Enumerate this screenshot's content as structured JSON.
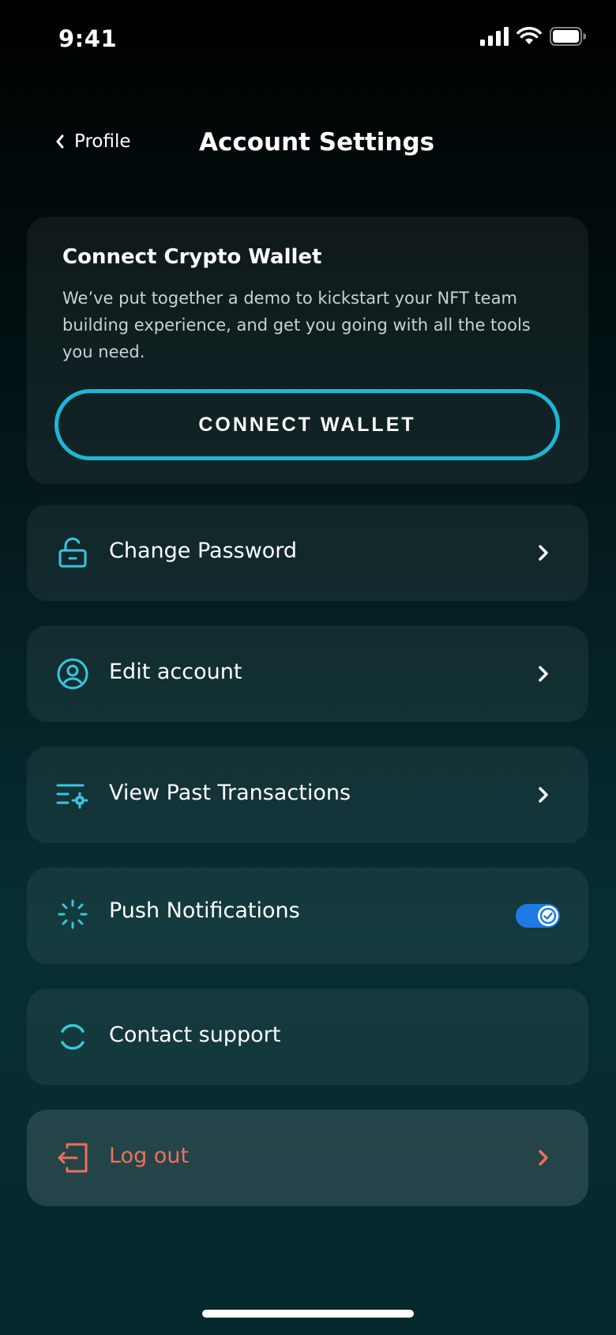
{
  "status_bar": {
    "time": "9:41",
    "icons": [
      "signal-icon",
      "wifi-icon",
      "battery-icon"
    ]
  },
  "nav": {
    "back_label": "Profile",
    "title": "Account Settings"
  },
  "wallet": {
    "title": "Connect Crypto Wallet",
    "description": "We’ve put together a demo to kickstart your NFT team building experience, and get you going with all the tools you need.",
    "button_label": "CONNECT WALLET"
  },
  "settings": {
    "change_password": {
      "label": "Change Password",
      "icon": "unlock-icon"
    },
    "edit_account": {
      "label": "Edit account",
      "icon": "user-circle-icon"
    },
    "past_transactions": {
      "label": "View Past Transactions",
      "icon": "list-settings-icon"
    },
    "push_notifications": {
      "label": "Push Notifications",
      "icon": "loader-icon",
      "enabled": true
    },
    "contact_support": {
      "label": "Contact support",
      "icon": "refresh-circle-icon"
    },
    "log_out": {
      "label": "Log out",
      "icon": "logout-icon"
    }
  },
  "colors": {
    "accent": "#1ab8d4",
    "icon": "#38c6e0",
    "toggle_on": "#1e7be6",
    "danger": "#ee6f5e"
  }
}
